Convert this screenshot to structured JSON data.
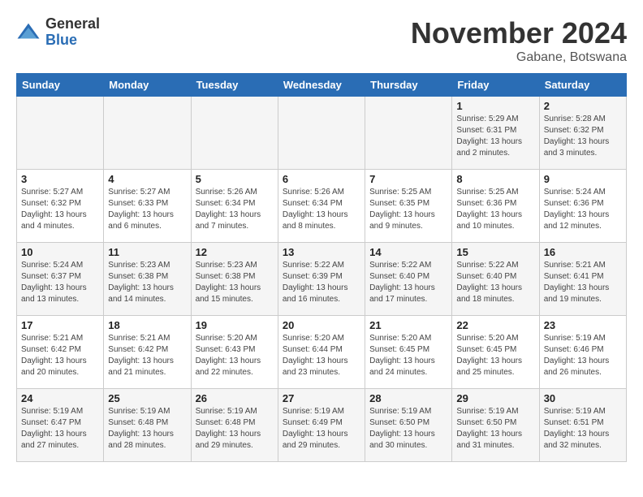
{
  "logo": {
    "general": "General",
    "blue": "Blue"
  },
  "title": "November 2024",
  "location": "Gabane, Botswana",
  "days_of_week": [
    "Sunday",
    "Monday",
    "Tuesday",
    "Wednesday",
    "Thursday",
    "Friday",
    "Saturday"
  ],
  "weeks": [
    [
      {
        "day": "",
        "info": ""
      },
      {
        "day": "",
        "info": ""
      },
      {
        "day": "",
        "info": ""
      },
      {
        "day": "",
        "info": ""
      },
      {
        "day": "",
        "info": ""
      },
      {
        "day": "1",
        "info": "Sunrise: 5:29 AM\nSunset: 6:31 PM\nDaylight: 13 hours\nand 2 minutes."
      },
      {
        "day": "2",
        "info": "Sunrise: 5:28 AM\nSunset: 6:32 PM\nDaylight: 13 hours\nand 3 minutes."
      }
    ],
    [
      {
        "day": "3",
        "info": "Sunrise: 5:27 AM\nSunset: 6:32 PM\nDaylight: 13 hours\nand 4 minutes."
      },
      {
        "day": "4",
        "info": "Sunrise: 5:27 AM\nSunset: 6:33 PM\nDaylight: 13 hours\nand 6 minutes."
      },
      {
        "day": "5",
        "info": "Sunrise: 5:26 AM\nSunset: 6:34 PM\nDaylight: 13 hours\nand 7 minutes."
      },
      {
        "day": "6",
        "info": "Sunrise: 5:26 AM\nSunset: 6:34 PM\nDaylight: 13 hours\nand 8 minutes."
      },
      {
        "day": "7",
        "info": "Sunrise: 5:25 AM\nSunset: 6:35 PM\nDaylight: 13 hours\nand 9 minutes."
      },
      {
        "day": "8",
        "info": "Sunrise: 5:25 AM\nSunset: 6:36 PM\nDaylight: 13 hours\nand 10 minutes."
      },
      {
        "day": "9",
        "info": "Sunrise: 5:24 AM\nSunset: 6:36 PM\nDaylight: 13 hours\nand 12 minutes."
      }
    ],
    [
      {
        "day": "10",
        "info": "Sunrise: 5:24 AM\nSunset: 6:37 PM\nDaylight: 13 hours\nand 13 minutes."
      },
      {
        "day": "11",
        "info": "Sunrise: 5:23 AM\nSunset: 6:38 PM\nDaylight: 13 hours\nand 14 minutes."
      },
      {
        "day": "12",
        "info": "Sunrise: 5:23 AM\nSunset: 6:38 PM\nDaylight: 13 hours\nand 15 minutes."
      },
      {
        "day": "13",
        "info": "Sunrise: 5:22 AM\nSunset: 6:39 PM\nDaylight: 13 hours\nand 16 minutes."
      },
      {
        "day": "14",
        "info": "Sunrise: 5:22 AM\nSunset: 6:40 PM\nDaylight: 13 hours\nand 17 minutes."
      },
      {
        "day": "15",
        "info": "Sunrise: 5:22 AM\nSunset: 6:40 PM\nDaylight: 13 hours\nand 18 minutes."
      },
      {
        "day": "16",
        "info": "Sunrise: 5:21 AM\nSunset: 6:41 PM\nDaylight: 13 hours\nand 19 minutes."
      }
    ],
    [
      {
        "day": "17",
        "info": "Sunrise: 5:21 AM\nSunset: 6:42 PM\nDaylight: 13 hours\nand 20 minutes."
      },
      {
        "day": "18",
        "info": "Sunrise: 5:21 AM\nSunset: 6:42 PM\nDaylight: 13 hours\nand 21 minutes."
      },
      {
        "day": "19",
        "info": "Sunrise: 5:20 AM\nSunset: 6:43 PM\nDaylight: 13 hours\nand 22 minutes."
      },
      {
        "day": "20",
        "info": "Sunrise: 5:20 AM\nSunset: 6:44 PM\nDaylight: 13 hours\nand 23 minutes."
      },
      {
        "day": "21",
        "info": "Sunrise: 5:20 AM\nSunset: 6:45 PM\nDaylight: 13 hours\nand 24 minutes."
      },
      {
        "day": "22",
        "info": "Sunrise: 5:20 AM\nSunset: 6:45 PM\nDaylight: 13 hours\nand 25 minutes."
      },
      {
        "day": "23",
        "info": "Sunrise: 5:19 AM\nSunset: 6:46 PM\nDaylight: 13 hours\nand 26 minutes."
      }
    ],
    [
      {
        "day": "24",
        "info": "Sunrise: 5:19 AM\nSunset: 6:47 PM\nDaylight: 13 hours\nand 27 minutes."
      },
      {
        "day": "25",
        "info": "Sunrise: 5:19 AM\nSunset: 6:48 PM\nDaylight: 13 hours\nand 28 minutes."
      },
      {
        "day": "26",
        "info": "Sunrise: 5:19 AM\nSunset: 6:48 PM\nDaylight: 13 hours\nand 29 minutes."
      },
      {
        "day": "27",
        "info": "Sunrise: 5:19 AM\nSunset: 6:49 PM\nDaylight: 13 hours\nand 29 minutes."
      },
      {
        "day": "28",
        "info": "Sunrise: 5:19 AM\nSunset: 6:50 PM\nDaylight: 13 hours\nand 30 minutes."
      },
      {
        "day": "29",
        "info": "Sunrise: 5:19 AM\nSunset: 6:50 PM\nDaylight: 13 hours\nand 31 minutes."
      },
      {
        "day": "30",
        "info": "Sunrise: 5:19 AM\nSunset: 6:51 PM\nDaylight: 13 hours\nand 32 minutes."
      }
    ]
  ]
}
